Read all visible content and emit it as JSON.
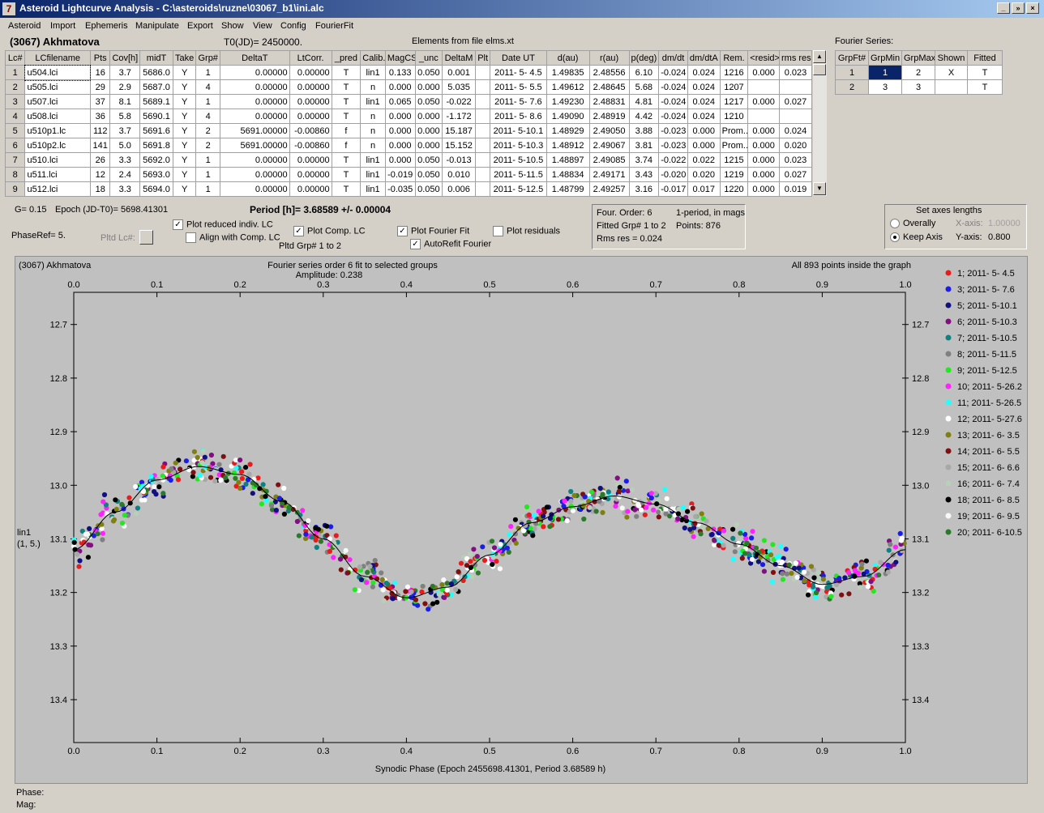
{
  "window": {
    "title": "Asteroid Lightcurve Analysis - C:\\asteroids\\ruzne\\03067_b1\\ini.alc",
    "icon": "app-icon",
    "minimize": "_",
    "restore": "»",
    "close": "×"
  },
  "menu": [
    "Asteroid",
    "Import",
    "Ephemeris",
    "Manipulate",
    "Export",
    "Show",
    "View",
    "Config",
    "FourierFit"
  ],
  "header": {
    "asteroid": "(3067) Akhmatova",
    "t0": "T0(JD)= 2450000.",
    "elements": "Elements from file elms.xt",
    "fourier_series_label": "Fourier Series:"
  },
  "lc_table": {
    "columns": [
      "Lc#",
      "LCfilename",
      "Pts",
      "Cov[h]",
      "midT",
      "Take",
      "Grp#",
      "DeltaT",
      "LtCorr.",
      "_pred",
      "Calib.",
      "MagCS",
      "_unc",
      "DeltaM",
      "Plt",
      "Date UT",
      "d(au)",
      "r(au)",
      "p(deg)",
      "dm/dt",
      "dm/dtA",
      "Rem.",
      "<resid>",
      "rms res"
    ],
    "rows": [
      [
        "1",
        "u504.lci",
        "16",
        "3.7",
        "5686.0",
        "Y",
        "1",
        "0.00000",
        "0.00000",
        "T",
        "lin1",
        "0.133",
        "0.050",
        "0.001",
        "",
        "2011- 5- 4.5",
        "1.49835",
        "2.48556",
        "6.10",
        "-0.024",
        "0.024",
        "1216",
        "0.000",
        "0.023"
      ],
      [
        "2",
        "u505.lci",
        "29",
        "2.9",
        "5687.0",
        "Y",
        "4",
        "0.00000",
        "0.00000",
        "T",
        "n",
        "0.000",
        "0.000",
        "5.035",
        "",
        "2011- 5- 5.5",
        "1.49612",
        "2.48645",
        "5.68",
        "-0.024",
        "0.024",
        "1207",
        "",
        ""
      ],
      [
        "3",
        "u507.lci",
        "37",
        "8.1",
        "5689.1",
        "Y",
        "1",
        "0.00000",
        "0.00000",
        "T",
        "lin1",
        "0.065",
        "0.050",
        "-0.022",
        "",
        "2011- 5- 7.6",
        "1.49230",
        "2.48831",
        "4.81",
        "-0.024",
        "0.024",
        "1217",
        "0.000",
        "0.027"
      ],
      [
        "4",
        "u508.lci",
        "36",
        "5.8",
        "5690.1",
        "Y",
        "4",
        "0.00000",
        "0.00000",
        "T",
        "n",
        "0.000",
        "0.000",
        "-1.172",
        "",
        "2011- 5- 8.6",
        "1.49090",
        "2.48919",
        "4.42",
        "-0.024",
        "0.024",
        "1210",
        "",
        ""
      ],
      [
        "5",
        "u510p1.lc",
        "112",
        "3.7",
        "5691.6",
        "Y",
        "2",
        "5691.00000",
        "-0.00860",
        "f",
        "n",
        "0.000",
        "0.000",
        "15.187",
        "",
        "2011- 5-10.1",
        "1.48929",
        "2.49050",
        "3.88",
        "-0.023",
        "0.000",
        "Prom...",
        "0.000",
        "0.024"
      ],
      [
        "6",
        "u510p2.lc",
        "141",
        "5.0",
        "5691.8",
        "Y",
        "2",
        "5691.00000",
        "-0.00860",
        "f",
        "n",
        "0.000",
        "0.000",
        "15.152",
        "",
        "2011- 5-10.3",
        "1.48912",
        "2.49067",
        "3.81",
        "-0.023",
        "0.000",
        "Prom...",
        "0.000",
        "0.020"
      ],
      [
        "7",
        "u510.lci",
        "26",
        "3.3",
        "5692.0",
        "Y",
        "1",
        "0.00000",
        "0.00000",
        "T",
        "lin1",
        "0.000",
        "0.050",
        "-0.013",
        "",
        "2011- 5-10.5",
        "1.48897",
        "2.49085",
        "3.74",
        "-0.022",
        "0.022",
        "1215",
        "0.000",
        "0.023"
      ],
      [
        "8",
        "u511.lci",
        "12",
        "2.4",
        "5693.0",
        "Y",
        "1",
        "0.00000",
        "0.00000",
        "T",
        "lin1",
        "-0.019",
        "0.050",
        "0.010",
        "",
        "2011- 5-11.5",
        "1.48834",
        "2.49171",
        "3.43",
        "-0.020",
        "0.020",
        "1219",
        "0.000",
        "0.027"
      ],
      [
        "9",
        "u512.lci",
        "18",
        "3.3",
        "5694.0",
        "Y",
        "1",
        "0.00000",
        "0.00000",
        "T",
        "lin1",
        "-0.035",
        "0.050",
        "0.006",
        "",
        "2011- 5-12.5",
        "1.48799",
        "2.49257",
        "3.16",
        "-0.017",
        "0.017",
        "1220",
        "0.000",
        "0.019"
      ]
    ]
  },
  "fourier_table": {
    "columns": [
      "GrpFt#",
      "GrpMin",
      "GrpMax",
      "Shown",
      "Fitted"
    ],
    "rows": [
      [
        "1",
        "1",
        "2",
        "X",
        "T"
      ],
      [
        "2",
        "3",
        "3",
        "",
        "T"
      ]
    ]
  },
  "params": {
    "g": "G= 0.15",
    "epoch": "Epoch (JD-T0)= 5698.41301",
    "period": "Period [h]= 3.68589 +/- 0.00004",
    "phaseref": "PhaseRef= 5.",
    "pltd_lc": "Pltd Lc#:",
    "pltd_grp": "Pltd Grp#  1   to   2"
  },
  "checkboxes": [
    {
      "label": "Plot reduced indiv. LC",
      "checked": true
    },
    {
      "label": "Align with Comp. LC",
      "checked": false
    },
    {
      "label": "Plot Comp. LC",
      "checked": true
    },
    {
      "label": "Plot Fourier Fit",
      "checked": true
    },
    {
      "label": "AutoRefit Fourier",
      "checked": true
    },
    {
      "label": "Plot residuals",
      "checked": false
    }
  ],
  "fit_info": {
    "order": "Four. Order:  6",
    "period_mode": "1-period, in mags",
    "fitted": "Fitted Grp# 1 to 2",
    "points": "Points: 876",
    "rms": "Rms res     = 0.024"
  },
  "axes_box": {
    "title": "Set axes lengths",
    "overally": "Overally",
    "keep_axis": "Keep Axis",
    "xaxis_label": "X-axis:",
    "xaxis_value": "1.00000",
    "yaxis_label": "Y-axis:",
    "yaxis_value": "0.800",
    "mode": "Keep Axis"
  },
  "chart_data": {
    "type": "scatter",
    "title_left": "(3067) Akhmatova",
    "title_center": "Fourier series order 6 fit to selected groups",
    "subtitle": "Amplitude: 0.238",
    "title_right": "All 893 points inside the graph",
    "xlabel": "Synodic Phase (Epoch 2455698.41301, Period 3.68589 h)",
    "ylabel": "lin1",
    "ylabel2": "(1, 5.)",
    "xlim": [
      0.0,
      1.0
    ],
    "ylim": [
      13.48,
      12.64
    ],
    "y_reversed": true,
    "xticks": [
      "0.0",
      "0.1",
      "0.2",
      "0.3",
      "0.4",
      "0.5",
      "0.6",
      "0.7",
      "0.8",
      "0.9",
      "1.0"
    ],
    "yticks": [
      "12.7",
      "12.8",
      "12.9",
      "13.0",
      "13.1",
      "13.2",
      "13.3",
      "13.4"
    ],
    "grid": false,
    "legend_position": "right",
    "fourier_fit": {
      "mean": 13.095,
      "amplitude": 0.238,
      "curve": [
        [
          0.0,
          13.12
        ],
        [
          0.05,
          13.05
        ],
        [
          0.1,
          12.99
        ],
        [
          0.15,
          12.965
        ],
        [
          0.2,
          12.98
        ],
        [
          0.25,
          13.03
        ],
        [
          0.3,
          13.1
        ],
        [
          0.35,
          13.17
        ],
        [
          0.4,
          13.21
        ],
        [
          0.45,
          13.19
        ],
        [
          0.5,
          13.13
        ],
        [
          0.55,
          13.07
        ],
        [
          0.6,
          13.04
        ],
        [
          0.65,
          13.02
        ],
        [
          0.7,
          13.035
        ],
        [
          0.75,
          13.07
        ],
        [
          0.8,
          13.11
        ],
        [
          0.85,
          13.15
        ],
        [
          0.9,
          13.185
        ],
        [
          0.95,
          13.17
        ],
        [
          1.0,
          13.12
        ]
      ]
    },
    "series": [
      {
        "name": "1; 2011- 5- 4.5",
        "color": "#e81c1c"
      },
      {
        "name": "3; 2011- 5- 7.6",
        "color": "#1c1ce8"
      },
      {
        "name": "5; 2011- 5-10.1",
        "color": "#101080"
      },
      {
        "name": "6; 2011- 5-10.3",
        "color": "#801080"
      },
      {
        "name": "7; 2011- 5-10.5",
        "color": "#108080"
      },
      {
        "name": "8; 2011- 5-11.5",
        "color": "#808080"
      },
      {
        "name": "9; 2011- 5-12.5",
        "color": "#22e822"
      },
      {
        "name": "10; 2011- 5-26.2",
        "color": "#ff22ff"
      },
      {
        "name": "11; 2011- 5-26.5",
        "color": "#22ffff"
      },
      {
        "name": "12; 2011- 5-27.6",
        "color": "#ffffff"
      },
      {
        "name": "13; 2011- 6- 3.5",
        "color": "#808010"
      },
      {
        "name": "14; 2011- 6- 5.5",
        "color": "#801010"
      },
      {
        "name": "15; 2011- 6- 6.6",
        "color": "#a8a8a8"
      },
      {
        "name": "16; 2011- 6- 7.4",
        "color": "#b8d0b8"
      },
      {
        "name": "18; 2011- 6- 8.5",
        "color": "#000000"
      },
      {
        "name": "19; 2011- 6- 9.5",
        "color": "#f8f8f8"
      },
      {
        "name": "20; 2011- 6-10.5",
        "color": "#2a7a2a"
      }
    ]
  },
  "statusbar": {
    "phase": "Phase:",
    "mag": "Mag:"
  }
}
